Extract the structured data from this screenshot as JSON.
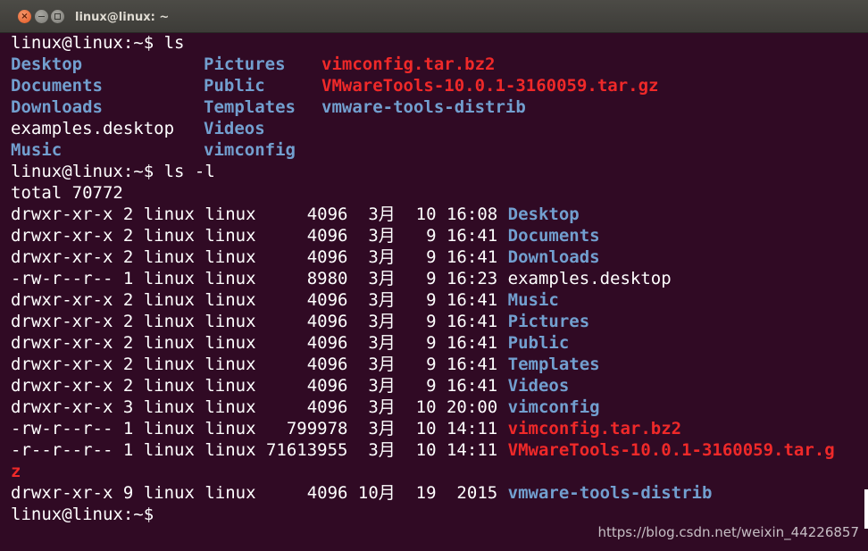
{
  "window": {
    "title": "linux@linux: ~",
    "close_glyph": "×"
  },
  "prompt": "linux@linux:~$",
  "commands": {
    "ls": " ls",
    "ls_l": " ls -l"
  },
  "ls_listing": [
    [
      {
        "text": "Desktop",
        "color": "blue"
      },
      {
        "text": "Pictures",
        "color": "blue"
      },
      {
        "text": "vimconfig.tar.bz2",
        "color": "red"
      }
    ],
    [
      {
        "text": "Documents",
        "color": "blue"
      },
      {
        "text": "Public",
        "color": "blue"
      },
      {
        "text": "VMwareTools-10.0.1-3160059.tar.gz",
        "color": "red"
      }
    ],
    [
      {
        "text": "Downloads",
        "color": "blue"
      },
      {
        "text": "Templates",
        "color": "blue"
      },
      {
        "text": "vmware-tools-distrib",
        "color": "blue"
      }
    ],
    [
      {
        "text": "examples.desktop",
        "color": "white"
      },
      {
        "text": "Videos",
        "color": "blue"
      },
      {
        "text": "",
        "color": "white"
      }
    ],
    [
      {
        "text": "Music",
        "color": "blue"
      },
      {
        "text": "vimconfig",
        "color": "blue"
      },
      {
        "text": "",
        "color": "white"
      }
    ]
  ],
  "total": "total 70772",
  "long_listing": [
    {
      "meta": "drwxr-xr-x 2 linux linux     4096  3月  10 16:08 ",
      "name": "Desktop",
      "color": "blue"
    },
    {
      "meta": "drwxr-xr-x 2 linux linux     4096  3月   9 16:41 ",
      "name": "Documents",
      "color": "blue"
    },
    {
      "meta": "drwxr-xr-x 2 linux linux     4096  3月   9 16:41 ",
      "name": "Downloads",
      "color": "blue"
    },
    {
      "meta": "-rw-r--r-- 1 linux linux     8980  3月   9 16:23 ",
      "name": "examples.desktop",
      "color": "white"
    },
    {
      "meta": "drwxr-xr-x 2 linux linux     4096  3月   9 16:41 ",
      "name": "Music",
      "color": "blue"
    },
    {
      "meta": "drwxr-xr-x 2 linux linux     4096  3月   9 16:41 ",
      "name": "Pictures",
      "color": "blue"
    },
    {
      "meta": "drwxr-xr-x 2 linux linux     4096  3月   9 16:41 ",
      "name": "Public",
      "color": "blue"
    },
    {
      "meta": "drwxr-xr-x 2 linux linux     4096  3月   9 16:41 ",
      "name": "Templates",
      "color": "blue"
    },
    {
      "meta": "drwxr-xr-x 2 linux linux     4096  3月   9 16:41 ",
      "name": "Videos",
      "color": "blue"
    },
    {
      "meta": "drwxr-xr-x 3 linux linux     4096  3月  10 20:00 ",
      "name": "vimconfig",
      "color": "blue"
    },
    {
      "meta": "-rw-r--r-- 1 linux linux   799978  3月  10 14:11 ",
      "name": "vimconfig.tar.bz2",
      "color": "red"
    },
    {
      "meta": "-r--r--r-- 1 linux linux 71613955  3月  10 14:11 ",
      "name": "VMwareTools-10.0.1-3160059.tar.g",
      "color": "red"
    },
    {
      "meta": "",
      "name": "z",
      "color": "red"
    },
    {
      "meta": "drwxr-xr-x 9 linux linux     4096 10月  19  2015 ",
      "name": "vmware-tools-distrib",
      "color": "blue"
    }
  ],
  "watermark": "https://blog.csdn.net/weixin_44226857",
  "colors": {
    "background": "#300a24",
    "directory": "#729fcf",
    "archive": "#ef2929",
    "text": "#ffffff"
  }
}
